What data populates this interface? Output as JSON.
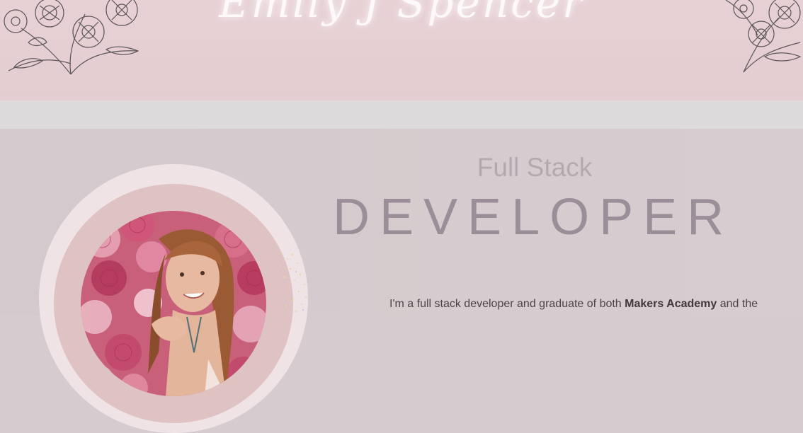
{
  "header": {
    "logo_text": "Emily J Spencer"
  },
  "hero": {
    "kicker": "Full Stack",
    "headline": "DEVELOPER",
    "intro": {
      "part1": "I'm a full stack developer and graduate of both ",
      "highlight": "Makers Academy",
      "part2": " and the"
    }
  },
  "colors": {
    "header_bg": "#e5cfd3",
    "band_bg": "#dcdadb",
    "main_bg": "#d6ccd0",
    "headline": "#9b8e99",
    "kicker": "#b5a9b0"
  },
  "icons": [
    "floral-illustration-icon",
    "sparkles-icon"
  ]
}
